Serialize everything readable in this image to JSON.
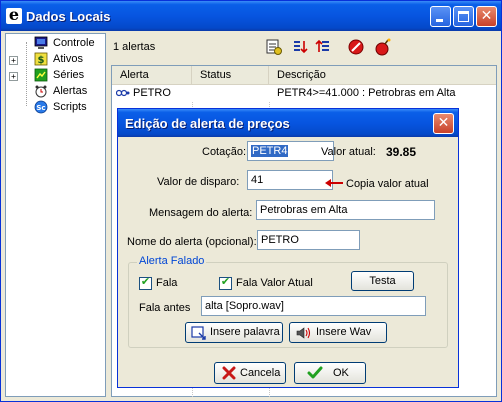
{
  "window": {
    "title": "Dados Locais"
  },
  "tree": {
    "items": [
      {
        "label": "Controle",
        "icon": "monitor-icon",
        "expandable": false
      },
      {
        "label": "Ativos",
        "icon": "dollar-icon",
        "expandable": true,
        "expander": "+"
      },
      {
        "label": "Séries",
        "icon": "series-chart-icon",
        "expandable": true,
        "expander": "+"
      },
      {
        "label": "Alertas",
        "icon": "alarm-clock-icon",
        "expandable": false
      },
      {
        "label": "Scripts",
        "icon": "script-icon",
        "expandable": false
      }
    ]
  },
  "toolbar": {
    "count_label": "1 alertas",
    "icons": [
      "new-alert-icon",
      "edit-alert-icon",
      "sort-alert-icon",
      "stop-icon",
      "bomb-icon"
    ]
  },
  "list": {
    "columns": [
      "Alerta",
      "Status",
      "Descrição"
    ],
    "rows": [
      {
        "alerta": "PETRO",
        "status": "",
        "descricao": "PETR4>=41.000 : Petrobras em Alta"
      }
    ]
  },
  "dialog": {
    "title": "Edição de alerta de preços",
    "cotacao_label": "Cotação:",
    "cotacao_value": "PETR4",
    "valor_atual_label": "Valor atual:",
    "valor_atual_value": "39.85",
    "disparo_label": "Valor de disparo:",
    "disparo_value": "41",
    "copia_label": "Copia valor atual",
    "mensagem_label": "Mensagem do alerta:",
    "mensagem_value": "Petrobras em Alta",
    "nome_label": "Nome do alerta (opcional):",
    "nome_value": "PETRO",
    "group_legend": "Alerta Falado",
    "fala_label": "Fala",
    "fala_checked": true,
    "fala_valor_label": "Fala Valor Atual",
    "fala_valor_checked": true,
    "testa_label": "Testa",
    "fala_antes_label": "Fala antes",
    "fala_antes_value": "alta  [Sopro.wav]",
    "insere_palavra_label": "Insere palavra",
    "insere_wav_label": "Insere Wav",
    "cancel_label": "Cancela",
    "ok_label": "OK"
  },
  "colors": {
    "accent": "#0755e0",
    "group_legend": "#0046d5",
    "arrow": "#cc0000"
  }
}
